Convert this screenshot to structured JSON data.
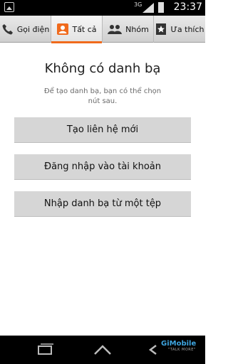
{
  "status_bar": {
    "network": "3G",
    "time": "23:37"
  },
  "tabs": [
    {
      "label": "Gọi điện",
      "icon": "phone-icon",
      "active": false
    },
    {
      "label": "Tất cả",
      "icon": "contacts-icon",
      "active": true
    },
    {
      "label": "Nhóm",
      "icon": "group-icon",
      "active": false
    },
    {
      "label": "Ưa thích",
      "icon": "star-icon",
      "active": false
    }
  ],
  "empty_state": {
    "title": "Không có danh bạ",
    "subtitle": "Để tạo danh bạ, bạn có thể chọn nút sau."
  },
  "buttons": {
    "create_contact": "Tạo liên hệ mới",
    "sign_in": "Đăng nhập vào tài khoản",
    "import": "Nhập danh bạ từ một tệp"
  },
  "watermark": {
    "brand": "GiMobile",
    "tagline": "\"TALK MORE\""
  },
  "colors": {
    "accent": "#f06a1c",
    "button_bg": "#d6d6d6"
  }
}
